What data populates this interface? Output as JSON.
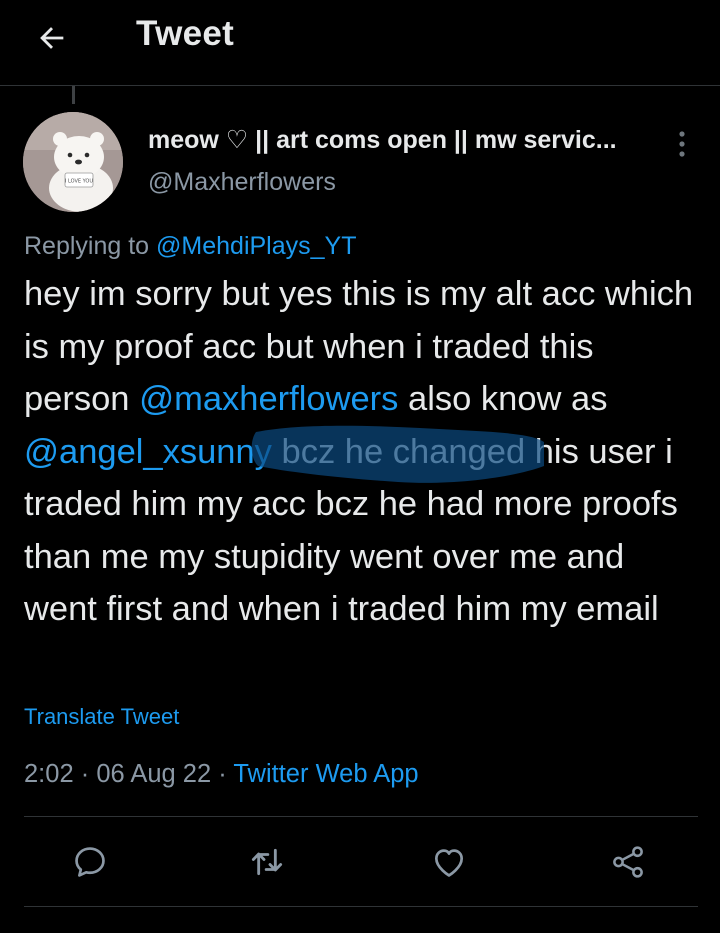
{
  "header": {
    "title": "Tweet",
    "back_icon": "arrow-left-icon"
  },
  "author": {
    "display_name": "meow ♡ || art coms open || mw servic...",
    "handle": "@Maxherflowers",
    "avatar_caption": "I LOVE YOU"
  },
  "reply": {
    "prefix": "Replying to ",
    "to_handle": "@MehdiPlays_YT"
  },
  "tweet": {
    "parts": [
      "hey im sorry but yes this is my alt acc which is my proof acc but when i traded this person ",
      "@maxherflowers",
      " also know as ",
      "@angel_xsunny",
      " bcz he changed his user i traded him my acc bcz he had more proofs than me my stupidity went over me and went first and when i traded him my email"
    ]
  },
  "translate_label": "Translate Tweet",
  "meta": {
    "time": "2:02",
    "separator": " · ",
    "date": "06 Aug 22",
    "source": "Twitter Web App"
  },
  "actions": [
    {
      "name": "reply",
      "icon": "reply-icon"
    },
    {
      "name": "retweet",
      "icon": "retweet-icon"
    },
    {
      "name": "like",
      "icon": "heart-icon"
    },
    {
      "name": "share",
      "icon": "share-icon"
    }
  ],
  "colors": {
    "background": "#000000",
    "text": "#e7e9ea",
    "secondary": "#8b98a5",
    "link": "#1d9bf0",
    "divider": "#2f3336",
    "scribble": "#0b4a80"
  }
}
